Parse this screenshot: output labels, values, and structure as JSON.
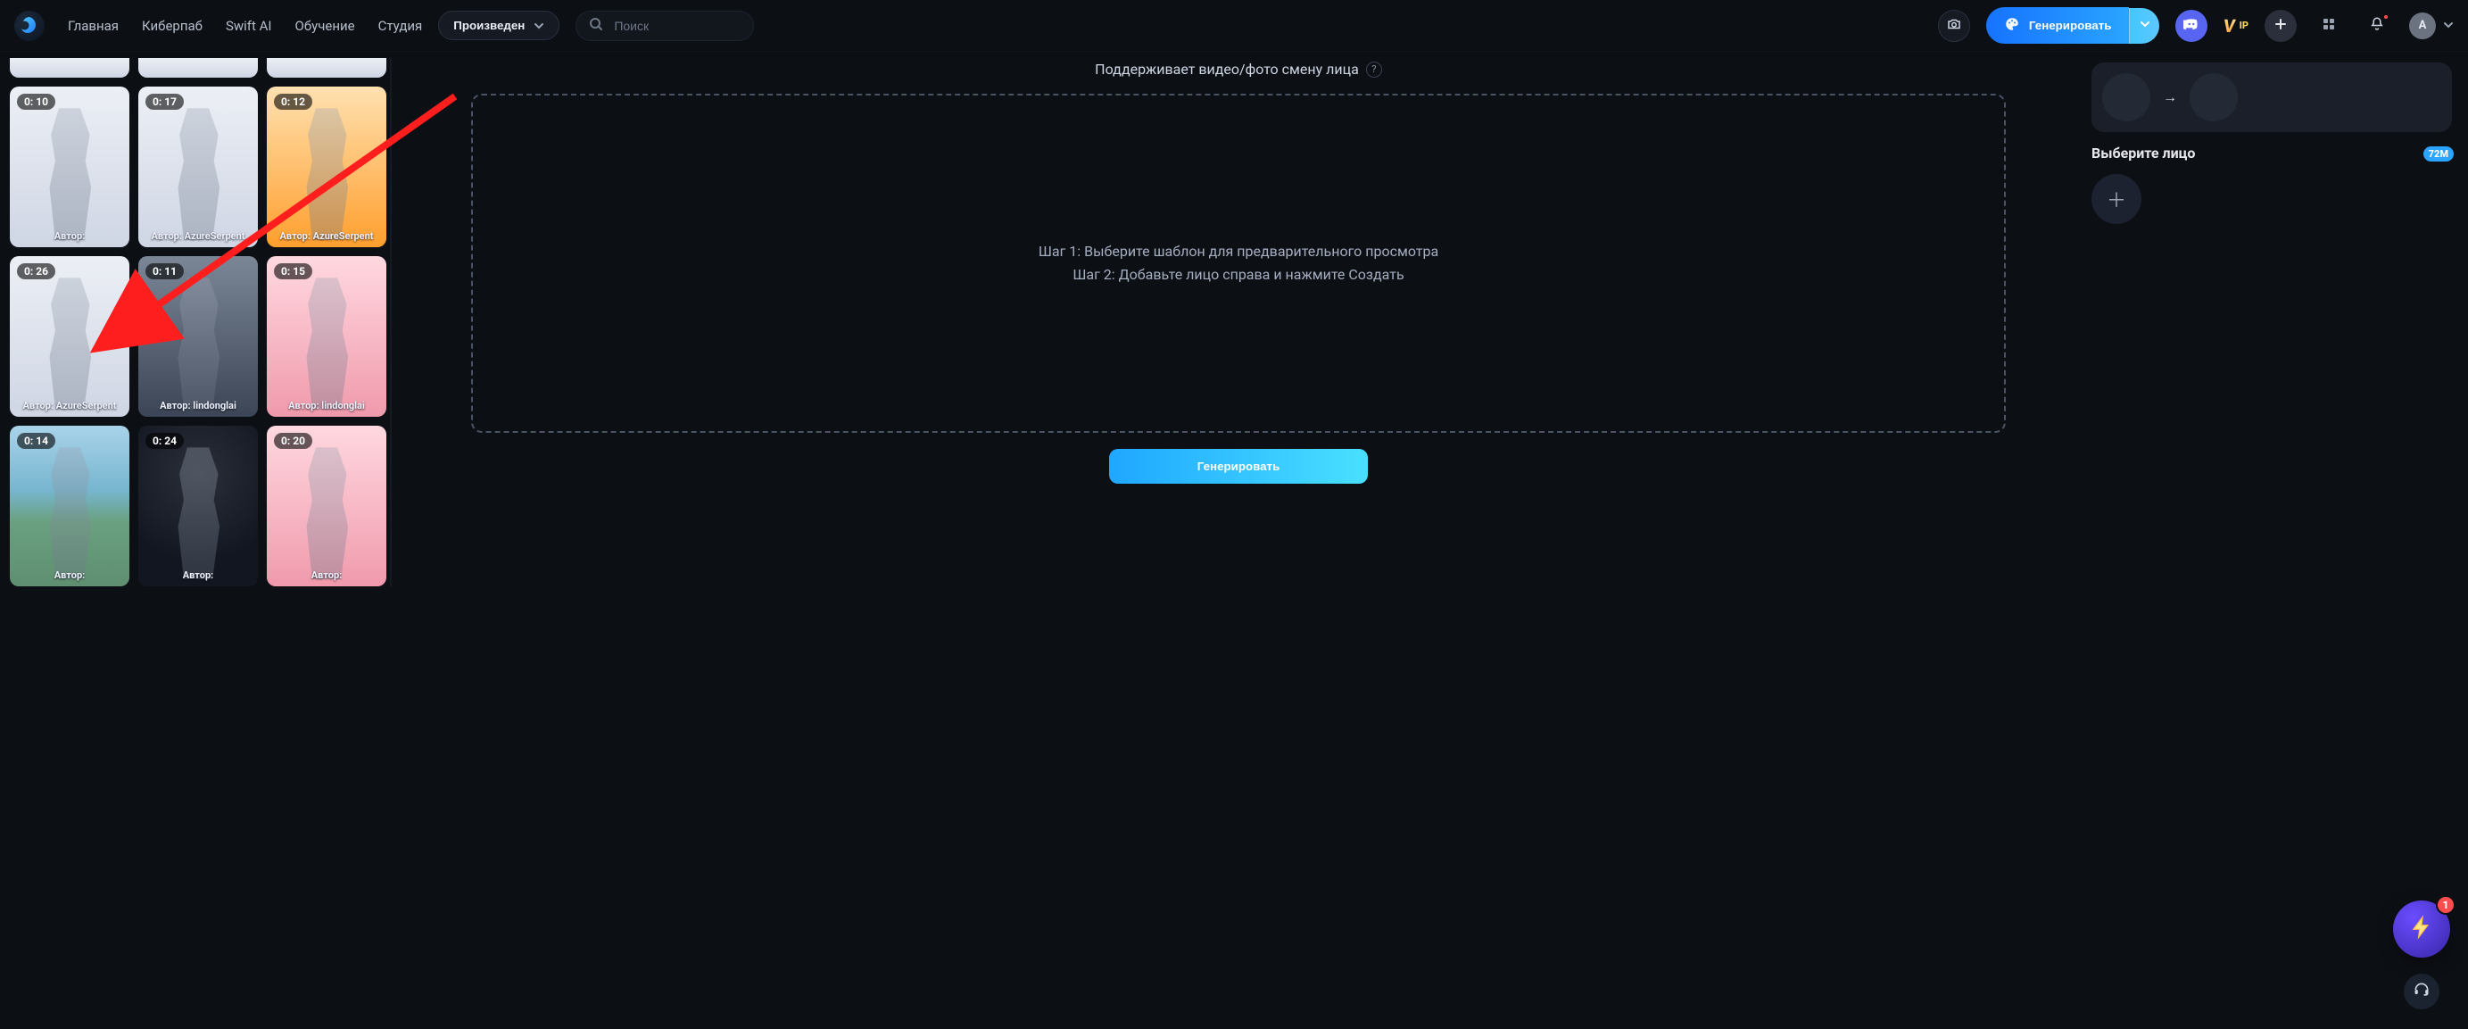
{
  "nav": {
    "items": [
      {
        "label": "Главная"
      },
      {
        "label": "Киберпаб"
      },
      {
        "label": "Swift AI"
      },
      {
        "label": "Обучение"
      },
      {
        "label": "Студия"
      }
    ]
  },
  "category": {
    "label": "Произведен"
  },
  "search": {
    "placeholder": "Поиск"
  },
  "topbar": {
    "generate_label": "Генерировать",
    "avatar_initial": "A",
    "vip_label_v": "V",
    "vip_label_ip": "IP"
  },
  "center": {
    "subhead": "Поддерживает видео/фото смену лица",
    "step1": "Шаг 1: Выберите шаблон для предварительного просмотра",
    "step2": "Шаг 2: Добавьте лицо справа и нажмите Создать",
    "cta_label": "Генерировать"
  },
  "right": {
    "select_face_title": "Выберите лицо",
    "pill_label": "72M",
    "swap_arrow": "→"
  },
  "floaters": {
    "badge": "1"
  },
  "templates": {
    "author_prefix": "Автор:",
    "items": [
      {
        "duration": "",
        "author": "",
        "bg": "bg-white"
      },
      {
        "duration": "",
        "author": "",
        "bg": "bg-white"
      },
      {
        "duration": "",
        "author": "",
        "bg": "bg-white"
      },
      {
        "duration": "0: 10",
        "author": "",
        "bg": "bg-white"
      },
      {
        "duration": "0: 17",
        "author": "AzureSerpent",
        "bg": "bg-white"
      },
      {
        "duration": "0: 12",
        "author": "AzureSerpent",
        "bg": "bg-orange"
      },
      {
        "duration": "0: 26",
        "author": "AzureSerpent",
        "bg": "bg-white"
      },
      {
        "duration": "0: 11",
        "author": "lindonglai",
        "bg": "bg-steel"
      },
      {
        "duration": "0: 15",
        "author": "lindonglai",
        "bg": "bg-pink"
      },
      {
        "duration": "0: 14",
        "author": "",
        "bg": "bg-beach"
      },
      {
        "duration": "0: 24",
        "author": "",
        "bg": "bg-stage"
      },
      {
        "duration": "0: 20",
        "author": "",
        "bg": "bg-pink"
      }
    ]
  }
}
